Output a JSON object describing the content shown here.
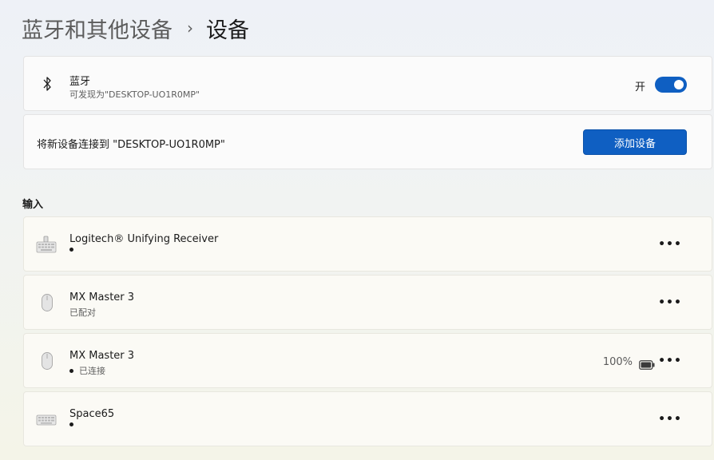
{
  "breadcrumb": {
    "parent": "蓝牙和其他设备",
    "separator": "›",
    "current": "设备"
  },
  "bluetooth": {
    "icon": "bluetooth-icon",
    "title": "蓝牙",
    "subtitle": "可发现为\"DESKTOP-UO1R0MP\"",
    "toggle_label": "开",
    "toggle_on": true
  },
  "connect": {
    "text": "将新设备连接到 \"DESKTOP-UO1R0MP\"",
    "button_label": "添加设备"
  },
  "input_section": {
    "label": "输入",
    "devices": [
      {
        "icon": "keyboard-icon",
        "name": "Logitech® Unifying Receiver",
        "status": "",
        "battery": ""
      },
      {
        "icon": "mouse-icon",
        "name": "MX Master 3",
        "status": "已配对",
        "battery": ""
      },
      {
        "icon": "mouse-icon",
        "name": "MX Master 3",
        "status": "已连接",
        "battery": "100%"
      },
      {
        "icon": "keyboard-icon",
        "name": "Space65",
        "status": "",
        "battery": ""
      }
    ]
  },
  "colors": {
    "accent": "#0f5fc2",
    "text": "#1b1b1b",
    "secondary_text": "#5f5f5f"
  }
}
